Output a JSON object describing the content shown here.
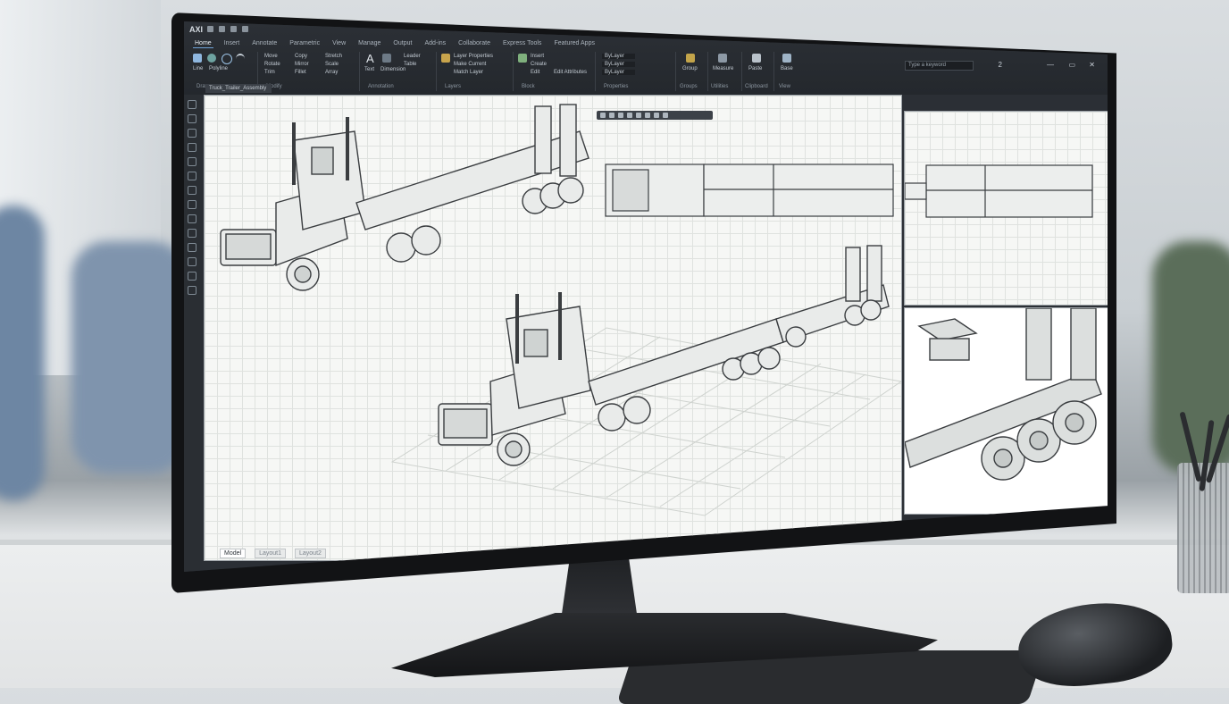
{
  "app": {
    "logo": "AXI",
    "tabs": [
      {
        "label": "Home",
        "active": true
      },
      {
        "label": "Insert"
      },
      {
        "label": "Annotate"
      },
      {
        "label": "Parametric"
      },
      {
        "label": "View"
      },
      {
        "label": "Manage"
      },
      {
        "label": "Output"
      },
      {
        "label": "Add-ins"
      },
      {
        "label": "Collaborate"
      },
      {
        "label": "Express Tools"
      },
      {
        "label": "Featured Apps"
      }
    ],
    "search_placeholder": "Type a keyword",
    "window_controls": [
      "—",
      "2",
      "▭",
      "✕"
    ]
  },
  "ribbon": {
    "panels": [
      {
        "title": "Draw",
        "tools": [
          "Line",
          "Polyline",
          "Circle",
          "Arc"
        ]
      },
      {
        "title": "Modify",
        "tools": [
          "Move",
          "Rotate",
          "Trim",
          "Copy",
          "Mirror",
          "Fillet",
          "Stretch",
          "Scale",
          "Array"
        ]
      },
      {
        "title": "Annotation",
        "tools": [
          "Text",
          "Dimension",
          "Leader",
          "Table"
        ]
      },
      {
        "title": "Layers",
        "tools": [
          "Layer Properties",
          "Make Current",
          "Match Layer"
        ]
      },
      {
        "title": "Block",
        "tools": [
          "Insert",
          "Create",
          "Edit",
          "Edit Attributes"
        ]
      },
      {
        "title": "Properties",
        "tools": [
          "ByLayer",
          "ByLayer",
          "ByLayer"
        ]
      },
      {
        "title": "Groups",
        "tools": [
          "Group"
        ]
      },
      {
        "title": "Utilities",
        "tools": [
          "Measure"
        ]
      },
      {
        "title": "Clipboard",
        "tools": [
          "Paste"
        ]
      },
      {
        "title": "View",
        "tools": [
          "Base"
        ]
      }
    ]
  },
  "file_tab": "Truck_Trailer_Assembly",
  "layout_tabs": [
    {
      "label": "Model",
      "active": true
    },
    {
      "label": "Layout1"
    },
    {
      "label": "Layout2"
    }
  ],
  "colors": {
    "ribbon": "#2c3036",
    "canvas": "#f6f7f5",
    "grid": "#dfe2df",
    "line": "#3a3d40",
    "accent": "#6fa3d8"
  },
  "icons": {
    "open": "folder-icon",
    "save": "save-icon",
    "undo": "undo-icon",
    "redo": "redo-icon",
    "user": "user-icon",
    "help": "help-icon"
  }
}
